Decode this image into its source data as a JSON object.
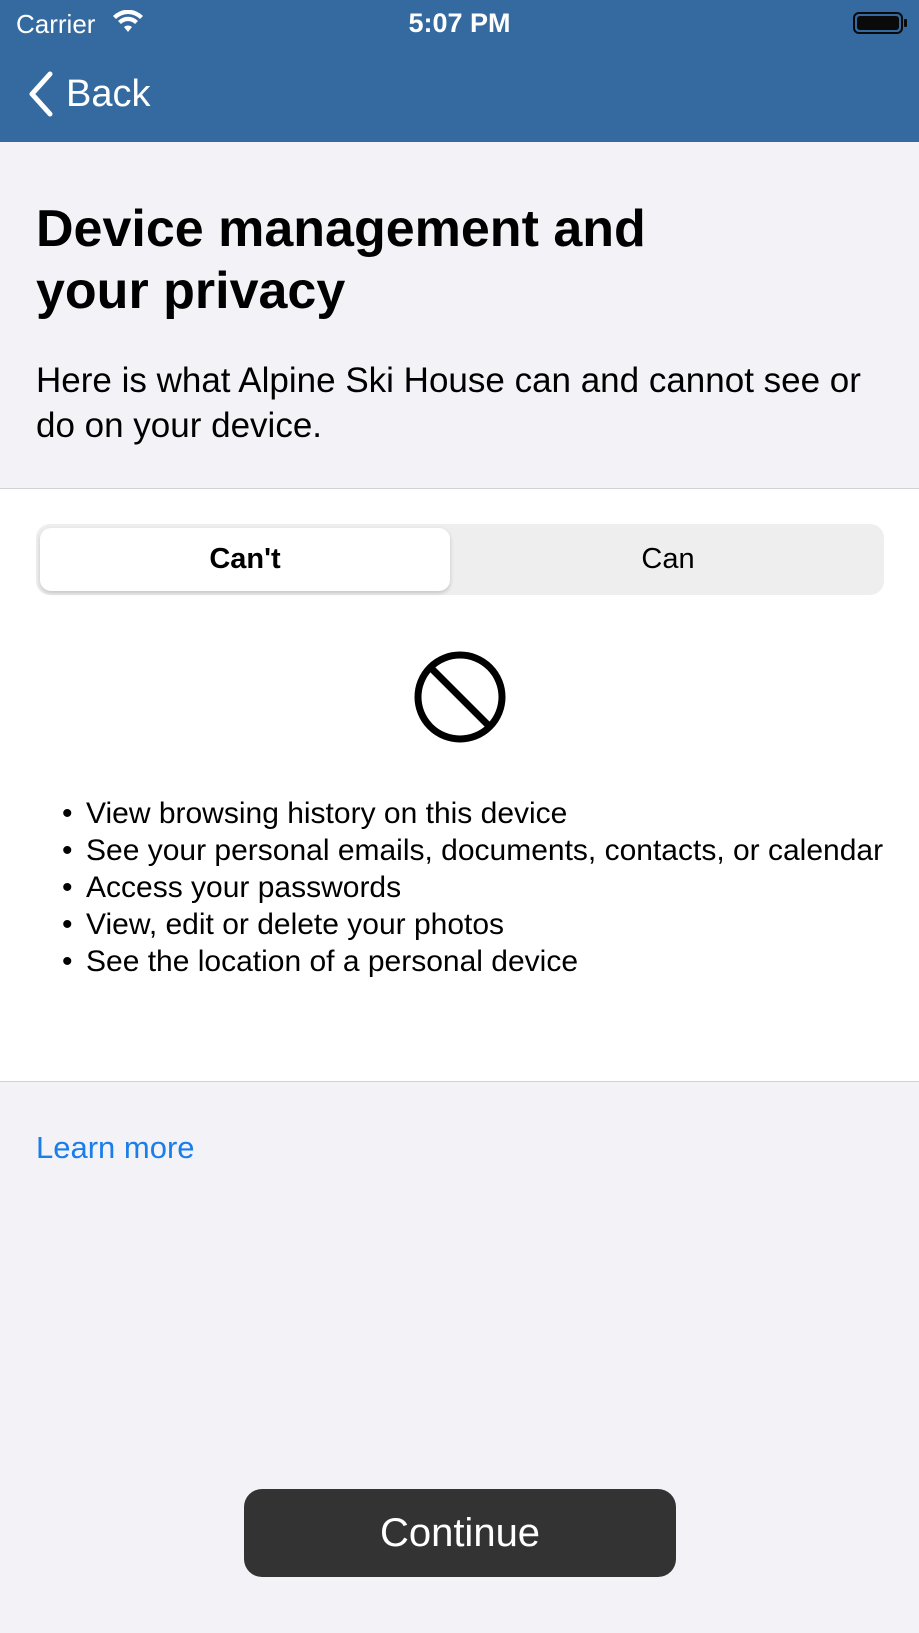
{
  "status_bar": {
    "carrier": "Carrier",
    "time": "5:07 PM"
  },
  "nav": {
    "back_label": "Back"
  },
  "header": {
    "title": "Device management and your privacy",
    "intro": "Here is what Alpine Ski House can and cannot see or do on your device."
  },
  "segment": {
    "selected": "Can't",
    "cant_label": "Can't",
    "can_label": "Can"
  },
  "cant_list": [
    "View browsing history on this device",
    "See your personal emails, documents, contacts, or calendar",
    "Access your passwords",
    "View, edit or delete your photos",
    "See the location of a personal device"
  ],
  "links": {
    "learn_more": "Learn more"
  },
  "footer": {
    "continue_label": "Continue"
  },
  "colors": {
    "nav_bar": "#346a9f",
    "link": "#1a7ee8",
    "primary_button": "#333333",
    "background": "#f2f2f7"
  },
  "icons": [
    "wifi-icon",
    "battery-icon",
    "back-chevron-icon",
    "prohibited-icon"
  ]
}
